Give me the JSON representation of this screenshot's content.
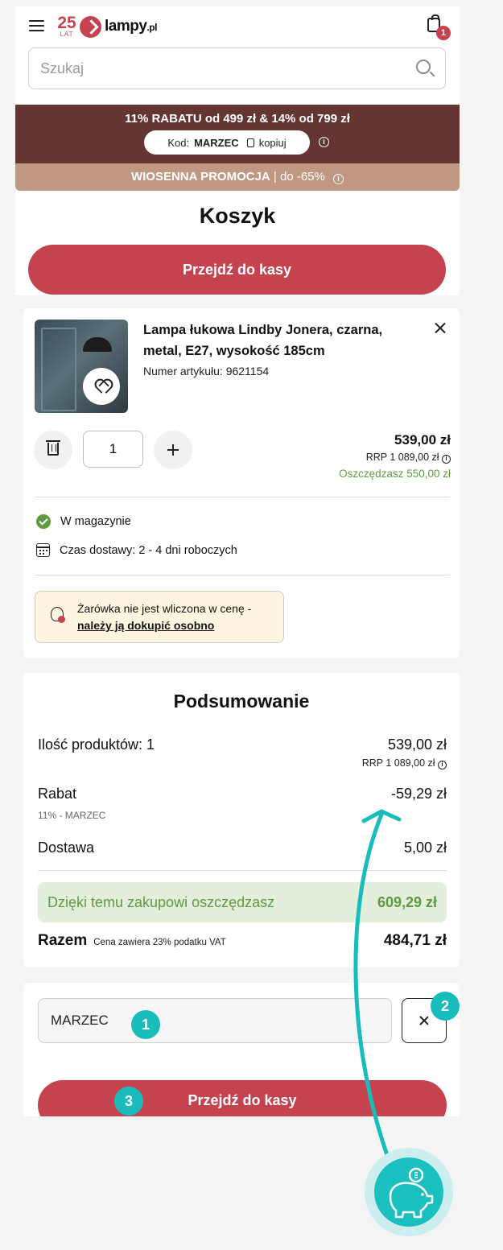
{
  "header": {
    "logo_number": "25",
    "logo_sub": "LAT",
    "logo_name": "lampy",
    "logo_tld": ".pl",
    "cart_count": "1",
    "search_placeholder": "Szukaj"
  },
  "promo": {
    "title": "11% RABATU od 499 zł & 14% od 799 zł",
    "code_label": "Kod:",
    "code": "MARZEC",
    "copy_label": "kopiuj",
    "secondary_bold": "WIOSENNA PROMOCJA",
    "secondary_rest": " | do -65%"
  },
  "cart": {
    "title": "Koszyk",
    "checkout_label": "Przejdź do kasy"
  },
  "product": {
    "name": "Lampa łukowa Lindby Jonera, czarna, metal, E27, wysokość 185cm",
    "sku": "Numer artykułu: 9621154",
    "quantity": "1",
    "price": "539,00 zł",
    "rrp": "RRP 1 089,00 zł",
    "savings": "Oszczędzasz 550,00 zł",
    "stock": "W magazynie",
    "delivery": "Czas dostawy: 2 - 4 dni roboczych",
    "bulb_note": "Żarówka nie jest wliczona w cenę -",
    "bulb_link": "należy ją dokupić osobno"
  },
  "summary": {
    "title": "Podsumowanie",
    "products_label": "Ilość produktów: 1",
    "products_value": "539,00 zł",
    "products_rrp": "RRP 1 089,00 zł",
    "discount_label": "Rabat",
    "discount_value": "-59,29 zł",
    "discount_sub": "11% - MARZEC",
    "shipping_label": "Dostawa",
    "shipping_value": "5,00 zł",
    "savings_label": "Dzięki temu zakupowi oszczędzasz",
    "savings_value": "609,29 zł",
    "total_label": "Razem",
    "total_note": "Cena zawiera 23% podatku VAT",
    "total_value": "484,71 zł"
  },
  "coupon": {
    "value": "MARZEC",
    "checkout_label": "Przejdź do kasy"
  },
  "annotations": {
    "marker_1": "1",
    "marker_2": "2",
    "marker_3": "3"
  },
  "colors": {
    "brand_red": "#c4434f",
    "promo_dark": "#643632",
    "promo_light": "#c09780",
    "success_green": "#5d9b3e",
    "annotation_teal": "#19bcbc"
  }
}
